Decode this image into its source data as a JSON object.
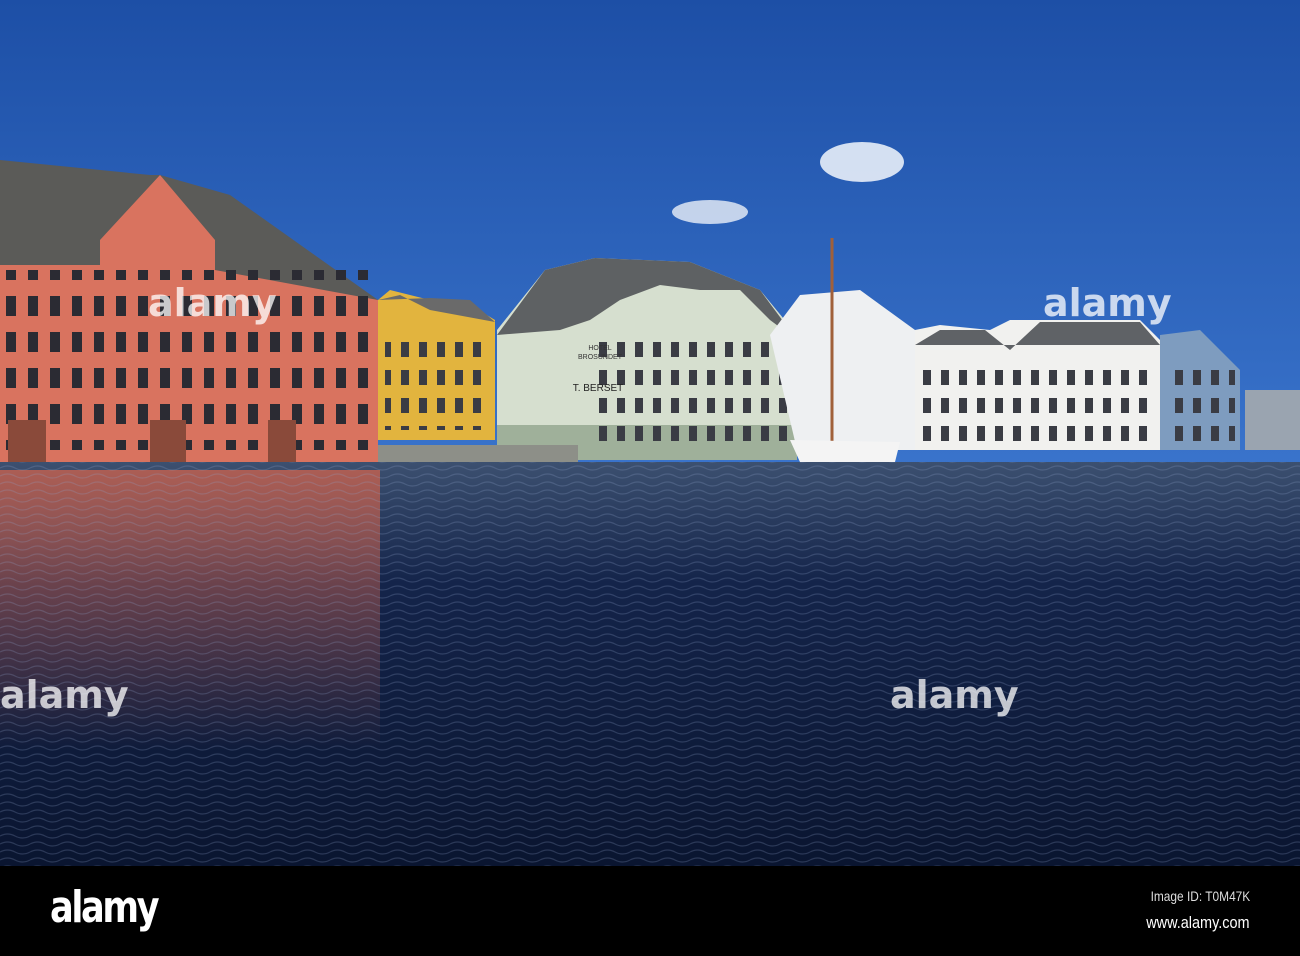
{
  "photo": {
    "subject": "Alesund harbour waterfront",
    "signs": {
      "hotel_line1": "HOTEL",
      "hotel_line2": "BROSUNDET",
      "store": "T. BERSET"
    }
  },
  "watermark": {
    "text": "alamy"
  },
  "footer": {
    "logo": "alamy",
    "image_id": "Image ID: T0M47K",
    "url": "www.alamy.com"
  },
  "colors": {
    "sky": "#2a5fb4",
    "water": "#0d1a3a",
    "salmon": "#d9735f",
    "yellow": "#e2b43e",
    "hotel": "#d6dfcf"
  }
}
